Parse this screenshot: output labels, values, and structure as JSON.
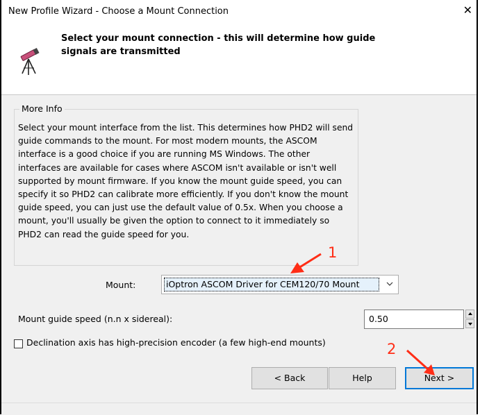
{
  "window": {
    "title": "New Profile Wizard - Choose a Mount Connection",
    "close_label": "✕"
  },
  "header": {
    "text": "Select your mount connection - this will determine how guide signals are transmitted",
    "icon": "telescope-icon"
  },
  "more_info": {
    "legend": "More Info",
    "text": "Select your mount interface from the list.  This determines how PHD2 will send guide commands to the mount. For most modern mounts, the ASCOM interface is a good choice if you are running MS Windows.  The other interfaces are available for cases where ASCOM isn't available or isn't well supported by mount firmware.  If you know the mount guide speed, you can specify it  so PHD2 can calibrate more efficiently.  If you don't know the mount guide speed, you can just use the default value of 0.5x.  When you choose a mount, you'll usually be given the option to connect to it immediately so PHD2 can read the guide speed for you."
  },
  "mount": {
    "label": "Mount:",
    "selected": "iOptron ASCOM Driver for CEM120/70 Mount"
  },
  "guide_speed": {
    "label": "Mount guide speed (n.n x sidereal):",
    "value": "0.50"
  },
  "declination": {
    "label": "Declination axis has high-precision encoder (a few high-end mounts)",
    "checked": false
  },
  "buttons": {
    "back": "< Back",
    "help": "Help",
    "next": "Next >"
  },
  "annotations": {
    "one": "1",
    "two": "2",
    "color": "#ff2d16"
  }
}
